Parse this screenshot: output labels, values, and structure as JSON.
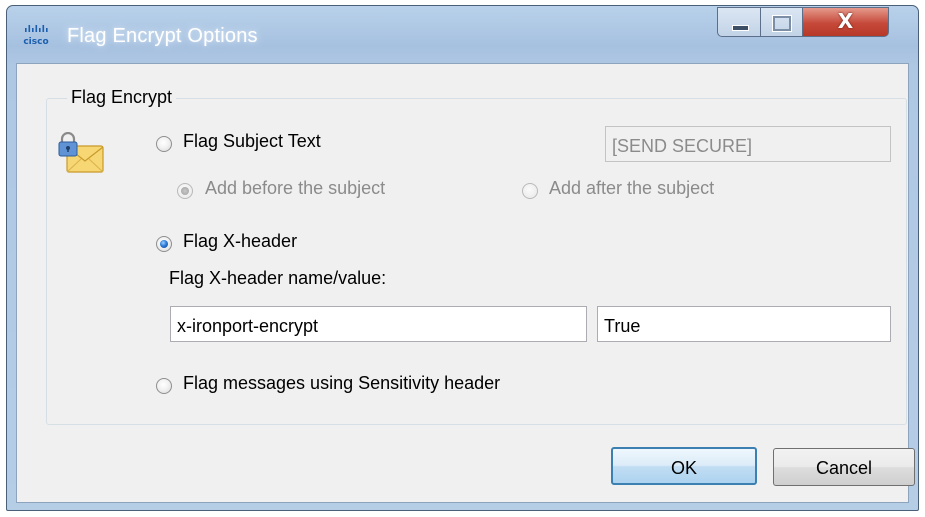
{
  "window": {
    "title": "Flag Encrypt Options",
    "controls": {
      "minimize": "minimize",
      "maximize": "maximize",
      "close": "X"
    }
  },
  "group": {
    "title": "Flag Encrypt",
    "flag_subject_text": {
      "label": "Flag Subject Text",
      "checked": false
    },
    "subject_text_value": "[SEND SECURE]",
    "add_before": {
      "label": "Add before the subject",
      "checked": true,
      "enabled": false
    },
    "add_after": {
      "label": "Add after the subject",
      "checked": false,
      "enabled": false
    },
    "flag_xheader": {
      "label": "Flag X-header",
      "checked": true
    },
    "xheader_caption": "Flag X-header name/value:",
    "xheader_name": "x-ironport-encrypt",
    "xheader_value": "True",
    "flag_sensitivity": {
      "label": "Flag messages using Sensitivity header",
      "checked": false
    }
  },
  "buttons": {
    "ok": "OK",
    "cancel": "Cancel"
  },
  "icons": {
    "app": "cisco-logo-icon",
    "group": "locked-envelope-icon"
  },
  "colors": {
    "titlebar": "#aec7e3",
    "close_button": "#c5493a",
    "dialog_bg": "#f0f0f0",
    "radio_checked": "#2c7bd6"
  }
}
